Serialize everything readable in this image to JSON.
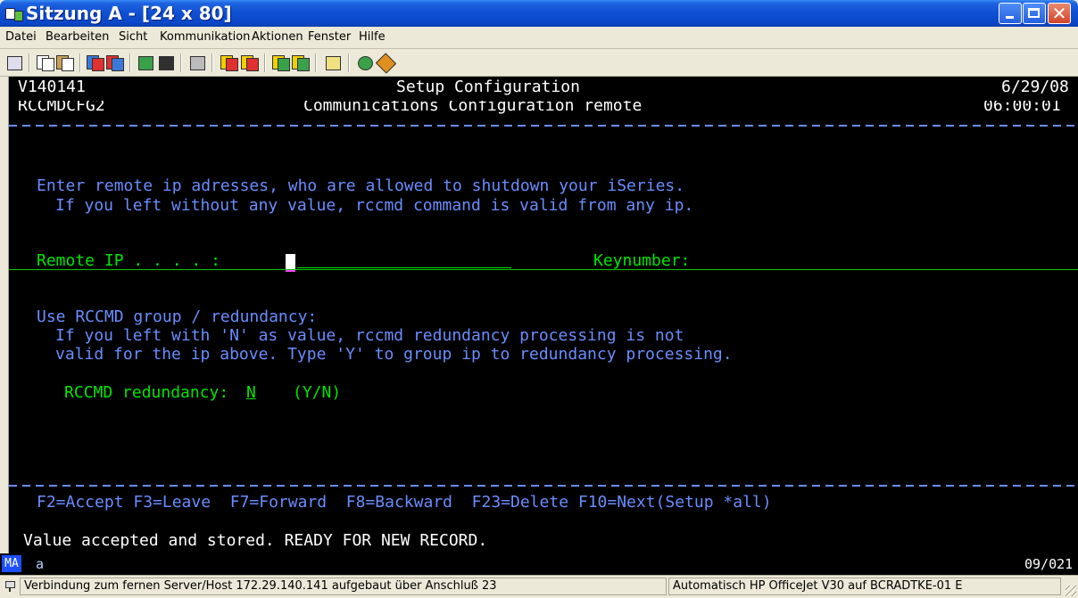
{
  "window": {
    "title": "Sitzung A - [24 x 80]"
  },
  "menu": {
    "items": [
      "Datei",
      "Bearbeiten",
      "Sicht",
      "Kommunikation",
      "Aktionen",
      "Fenster",
      "Hilfe"
    ]
  },
  "toolbar": {
    "icons": [
      "print-screen-icon",
      "copy-icon",
      "paste-icon",
      "send-file-icon",
      "receive-file-icon",
      "display-keypad-icon",
      "macro-icon",
      "record-macro-icon",
      "play-macro-icon",
      "stop-macro-icon",
      "customize-icon",
      "clipboard-icon",
      "globe-icon",
      "help-icon"
    ]
  },
  "terminal": {
    "program_id": "V140141",
    "screen_id": "RCCMDCFG2",
    "header_title": "Setup Configuration",
    "header_subtitle": "Communications Configuration remote",
    "date": "6/29/08",
    "time": "06:00:01",
    "instruction_line1": "Enter remote ip adresses, who are allowed to shutdown your iSeries.",
    "instruction_line2": "If you left without any value, rccmd command is valid from any ip.",
    "remote_ip_label": "Remote IP . . . . :",
    "remote_ip_value": "",
    "keynumber_label": "Keynumber:",
    "group_heading": "Use RCCMD group / redundancy:",
    "group_line1": "If you left with 'N' as value, rccmd redundancy processing is not",
    "group_line2": "valid for the ip above. Type 'Y' to group ip to redundancy processing.",
    "redundancy_label": "RCCMD redundancy:",
    "redundancy_value": "N",
    "redundancy_options": "(Y/N)",
    "function_keys": "F2=Accept F3=Leave  F7=Forward  F8=Backward  F23=Delete F10=Next(Setup *all)",
    "message": "Value accepted and stored. READY FOR NEW RECORD."
  },
  "oia": {
    "mode": "MA",
    "session": "a",
    "cursor_position": "09/021"
  },
  "statusbar": {
    "connection": "Verbindung zum fernen Server/Host 172.29.140.141 aufgebaut über Anschluß 23",
    "printer": "Automatisch HP OfficeJet V30 auf BCRADTKE-01 E"
  }
}
